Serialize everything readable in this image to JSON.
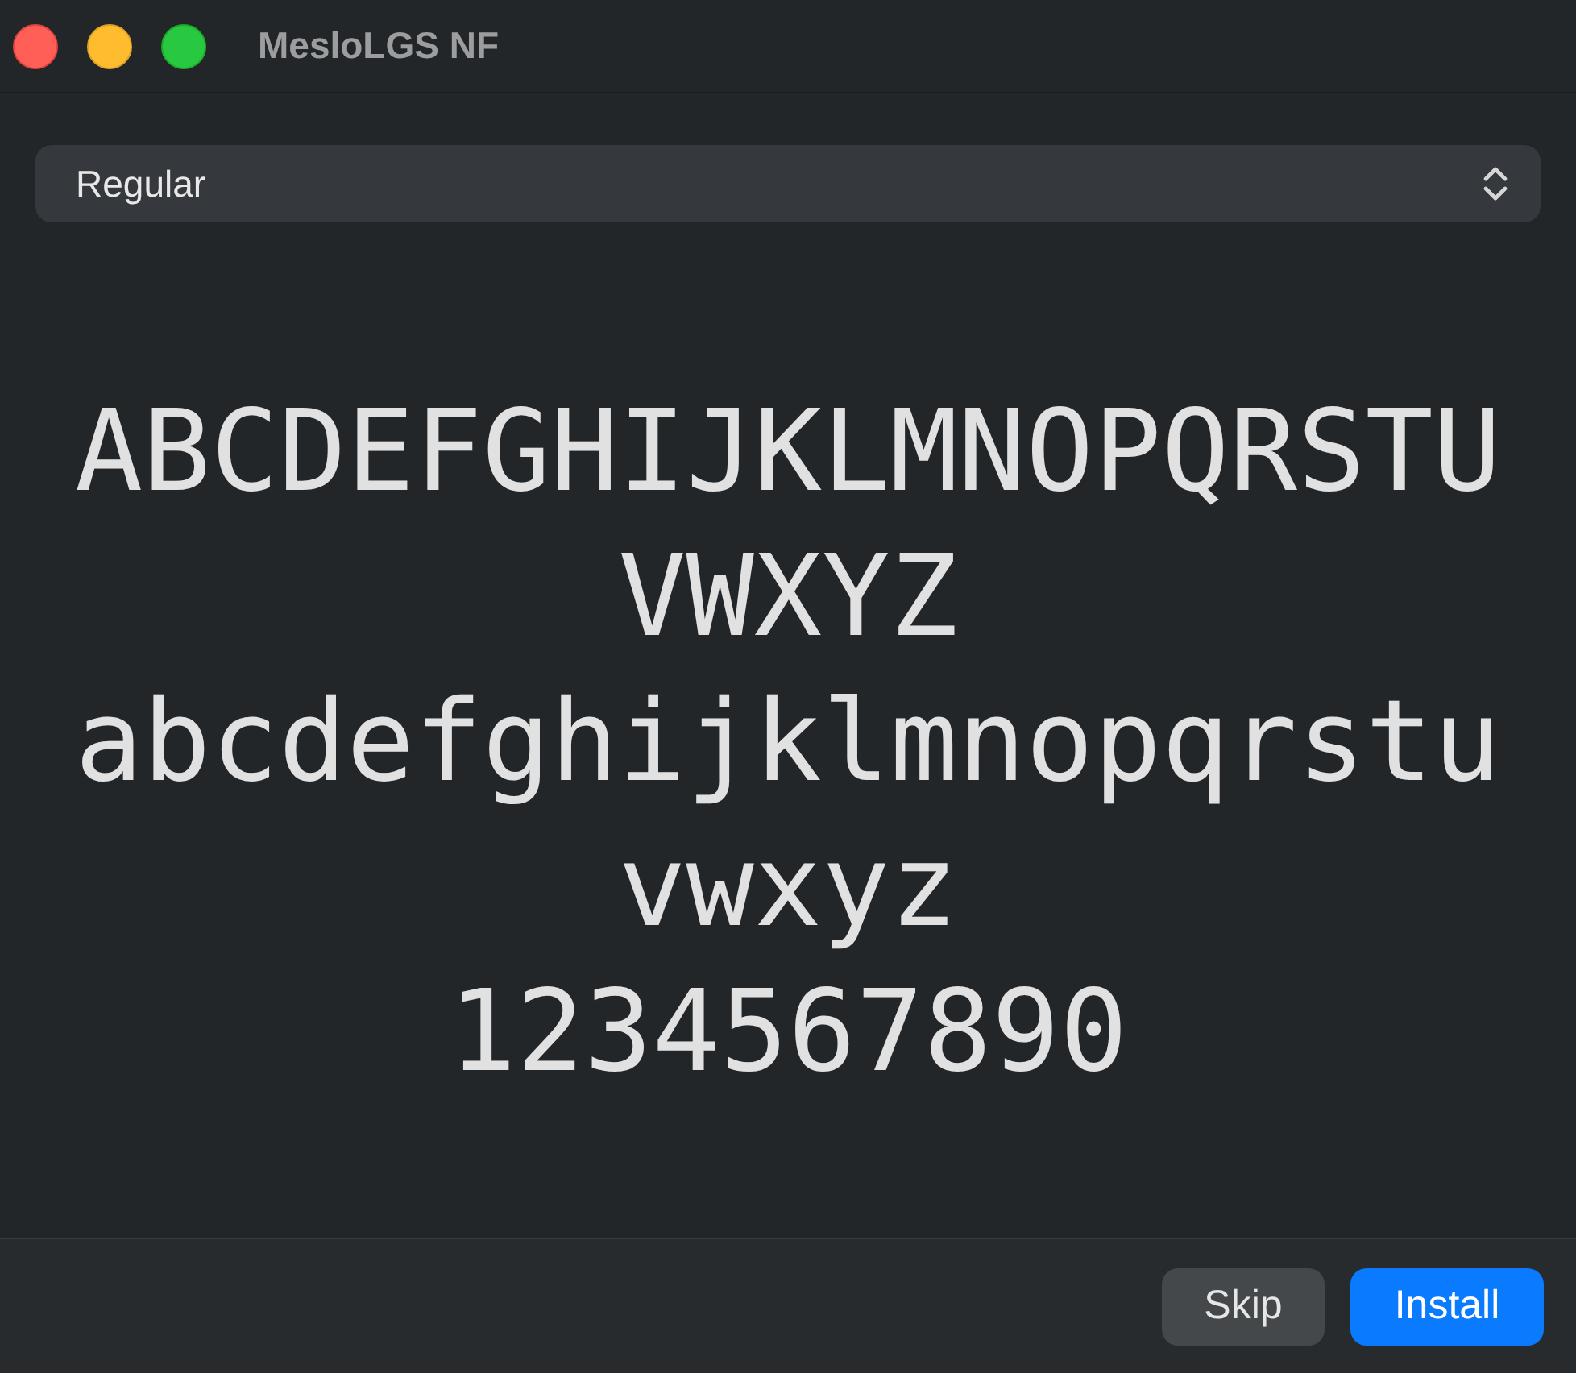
{
  "window": {
    "title": "MesloLGS NF"
  },
  "style_select": {
    "value": "Regular"
  },
  "preview": {
    "lines": [
      "ABCDEFGHIJKLMNOPQRSTUVWXYZ",
      "abcdefghijklmnopqrstuvwxyz",
      "1234567890"
    ]
  },
  "buttons": [
    {
      "label": "Skip",
      "kind": "secondary"
    },
    {
      "label": "Install",
      "kind": "primary"
    }
  ]
}
